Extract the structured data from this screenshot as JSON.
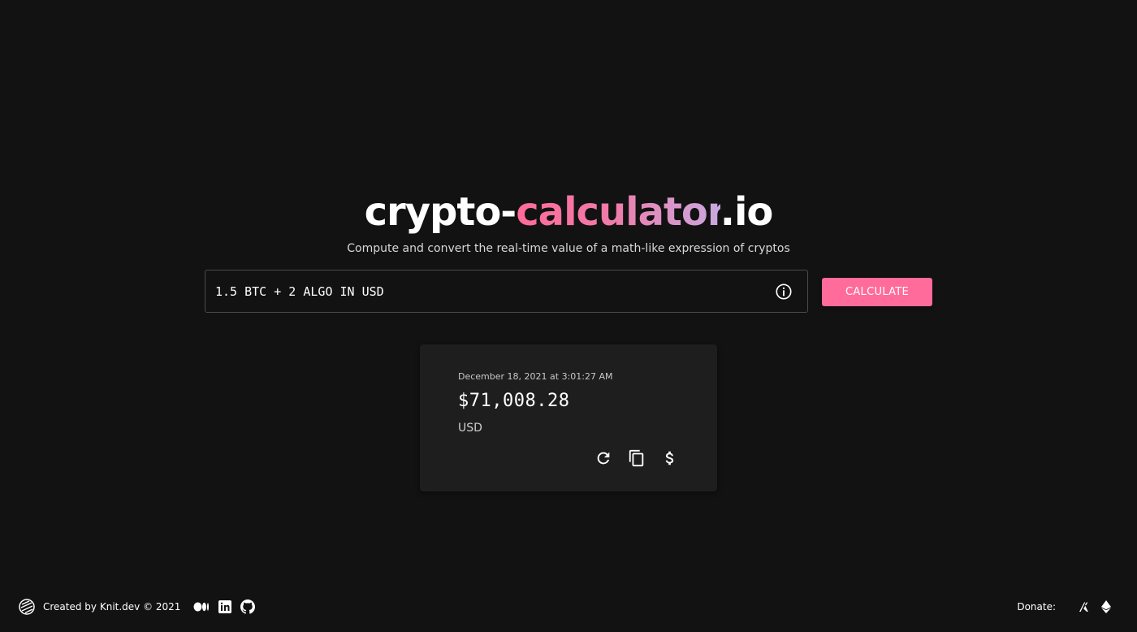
{
  "header": {
    "title_prefix": "crypto-",
    "title_highlight": "calculator",
    "title_suffix": ".io",
    "subtitle": "Compute and convert the real-time value of a math-like expression of cryptos"
  },
  "search": {
    "value": "1.5 BTC + 2 ALGO IN USD",
    "info_icon": "info-circle-icon",
    "button_label": "CALCULATE"
  },
  "result": {
    "timestamp": "December 18, 2021 at 3:01:27 AM",
    "amount": "$71,008.28",
    "currency": "USD",
    "actions": [
      "refresh-icon",
      "copy-icon",
      "dollar-icon"
    ]
  },
  "footer": {
    "credit": "Created by Knit.dev © 2021",
    "social_icons": [
      "medium-icon",
      "linkedin-icon",
      "github-icon"
    ],
    "donate_label": "Donate:",
    "donate_icons": [
      "algorand-icon",
      "ethereum-icon"
    ]
  },
  "colors": {
    "background": "#121212",
    "accent": "#ff6b9a",
    "gradient_end": "#c9a9e0",
    "card": "#1e1e1e"
  }
}
